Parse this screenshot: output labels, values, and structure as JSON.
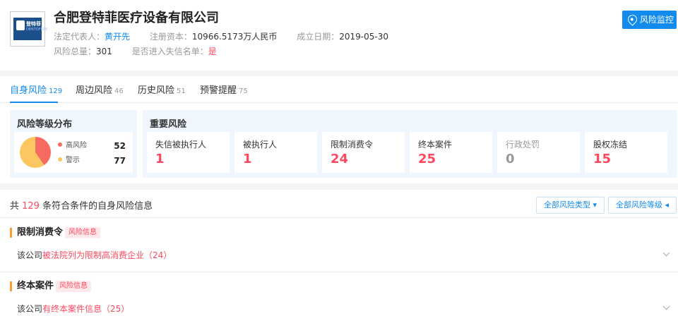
{
  "company": {
    "name": "合肥登特菲医疗设备有限公司",
    "logo_text": "登特菲",
    "logo_sub": "DENTOFREE",
    "legal_rep_label": "法定代表人：",
    "legal_rep": "黄开先",
    "capital_label": "注册资本：",
    "capital": "10966.5173万人民币",
    "founded_label": "成立日期：",
    "founded": "2019-05-30",
    "risk_total_label": "风险总量：",
    "risk_total": "301",
    "blacklist_label": "是否进入失信名单：",
    "blacklist": "是"
  },
  "monitor_button": "风险监控",
  "tabs": [
    {
      "label": "自身风险",
      "count": "129"
    },
    {
      "label": "周边风险",
      "count": "46"
    },
    {
      "label": "历史风险",
      "count": "51"
    },
    {
      "label": "预警提醒",
      "count": "75"
    }
  ],
  "distribution": {
    "title": "风险等级分布",
    "items": [
      {
        "label": "高风险",
        "value": "52",
        "color": "#f76a5f"
      },
      {
        "label": "警示",
        "value": "77",
        "color": "#fcc760"
      }
    ]
  },
  "key_risks": {
    "title": "重要风险",
    "items": [
      {
        "label": "失信被执行人",
        "value": "1"
      },
      {
        "label": "被执行人",
        "value": "1"
      },
      {
        "label": "限制消费令",
        "value": "24"
      },
      {
        "label": "终本案件",
        "value": "25"
      },
      {
        "label": "行政处罚",
        "value": "0"
      },
      {
        "label": "股权冻结",
        "value": "15"
      }
    ]
  },
  "list": {
    "summary_prefix": "共 ",
    "summary_count": "129",
    "summary_suffix": " 条符合条件的自身风险信息",
    "filter_type": "全部风险类型",
    "filter_level": "全部风险等级",
    "sections": [
      {
        "title": "限制消费令",
        "tag": "风险信息",
        "detail_prefix": "该公司",
        "detail_link": "被法院列为限制高消费企业",
        "detail_count": "（24）"
      },
      {
        "title": "终本案件",
        "tag": "风险信息",
        "detail_prefix": "该公司",
        "detail_link": "有终本案件信息",
        "detail_count": "（25）"
      }
    ]
  },
  "colors": {
    "accent": "#128bed",
    "danger": "#fd485e",
    "warn": "#ff9a2e"
  }
}
